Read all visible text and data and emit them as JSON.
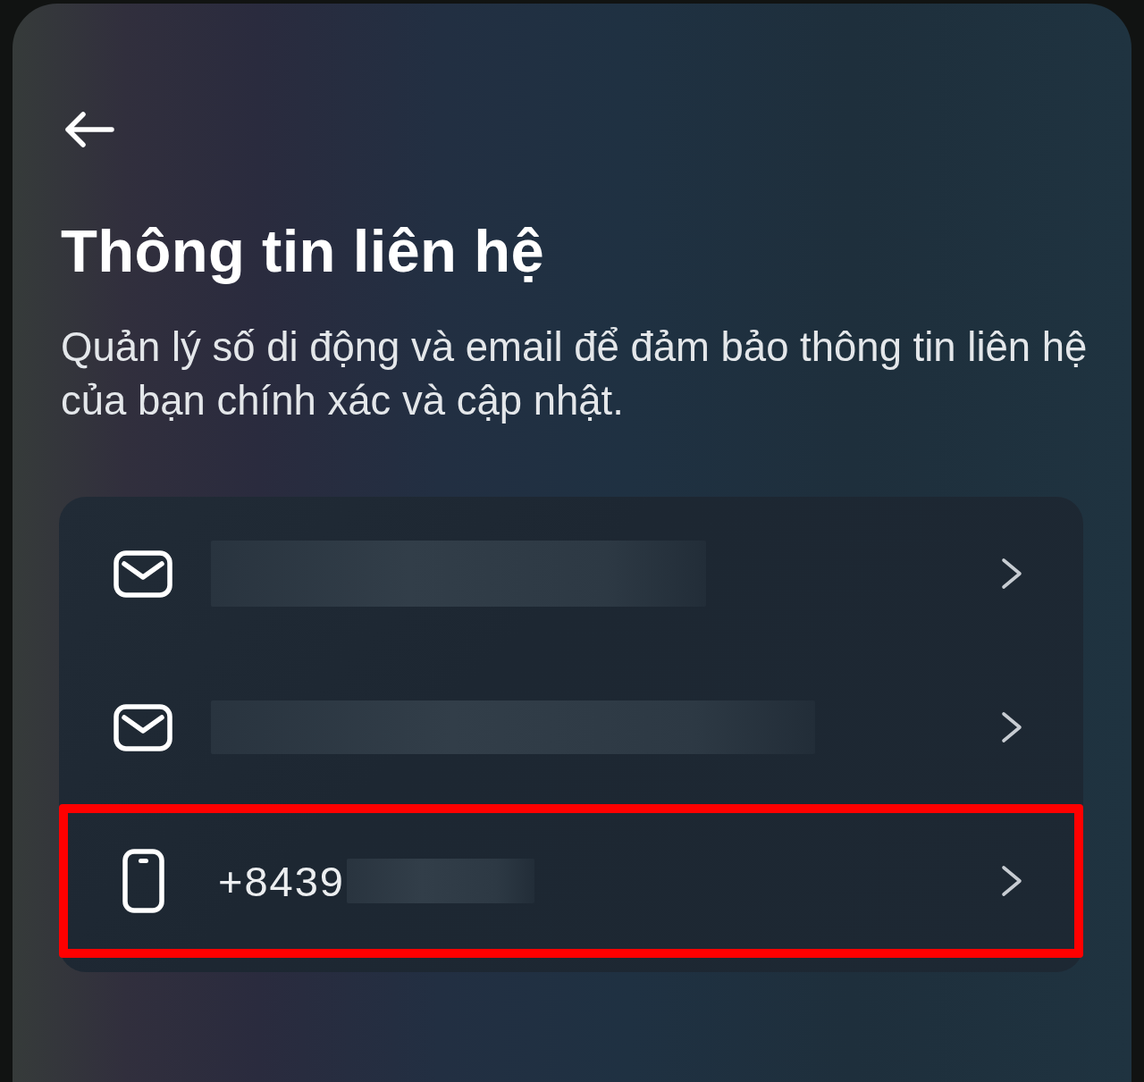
{
  "header": {
    "title": "Thông tin liên hệ",
    "description": "Quản lý số di động và email để đảm bảo thông tin liên hệ của bạn chính xác và cập nhật."
  },
  "contacts": [
    {
      "kind": "email",
      "redacted": true,
      "highlighted": false
    },
    {
      "kind": "email",
      "redacted": true,
      "highlighted": false
    },
    {
      "kind": "phone",
      "value": "+8439",
      "redacted": true,
      "highlighted": true
    }
  ]
}
